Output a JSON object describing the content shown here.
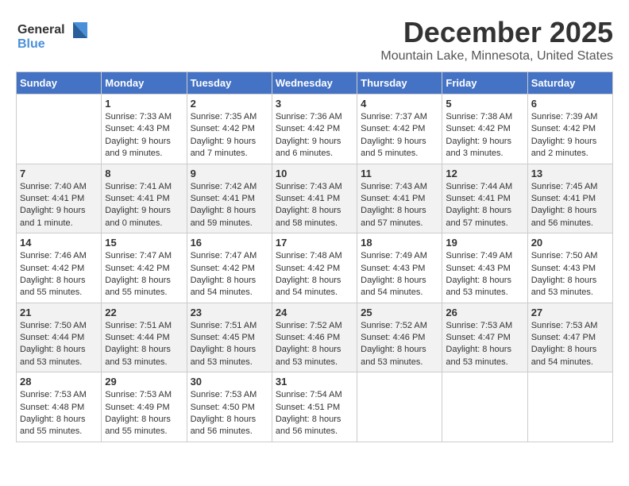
{
  "logo": {
    "text_general": "General",
    "text_blue": "Blue"
  },
  "title": "December 2025",
  "subtitle": "Mountain Lake, Minnesota, United States",
  "days_of_week": [
    "Sunday",
    "Monday",
    "Tuesday",
    "Wednesday",
    "Thursday",
    "Friday",
    "Saturday"
  ],
  "weeks": [
    [
      {
        "day": "",
        "info": ""
      },
      {
        "day": "1",
        "info": "Sunrise: 7:33 AM\nSunset: 4:43 PM\nDaylight: 9 hours\nand 9 minutes."
      },
      {
        "day": "2",
        "info": "Sunrise: 7:35 AM\nSunset: 4:42 PM\nDaylight: 9 hours\nand 7 minutes."
      },
      {
        "day": "3",
        "info": "Sunrise: 7:36 AM\nSunset: 4:42 PM\nDaylight: 9 hours\nand 6 minutes."
      },
      {
        "day": "4",
        "info": "Sunrise: 7:37 AM\nSunset: 4:42 PM\nDaylight: 9 hours\nand 5 minutes."
      },
      {
        "day": "5",
        "info": "Sunrise: 7:38 AM\nSunset: 4:42 PM\nDaylight: 9 hours\nand 3 minutes."
      },
      {
        "day": "6",
        "info": "Sunrise: 7:39 AM\nSunset: 4:42 PM\nDaylight: 9 hours\nand 2 minutes."
      }
    ],
    [
      {
        "day": "7",
        "info": "Sunrise: 7:40 AM\nSunset: 4:41 PM\nDaylight: 9 hours\nand 1 minute."
      },
      {
        "day": "8",
        "info": "Sunrise: 7:41 AM\nSunset: 4:41 PM\nDaylight: 9 hours\nand 0 minutes."
      },
      {
        "day": "9",
        "info": "Sunrise: 7:42 AM\nSunset: 4:41 PM\nDaylight: 8 hours\nand 59 minutes."
      },
      {
        "day": "10",
        "info": "Sunrise: 7:43 AM\nSunset: 4:41 PM\nDaylight: 8 hours\nand 58 minutes."
      },
      {
        "day": "11",
        "info": "Sunrise: 7:43 AM\nSunset: 4:41 PM\nDaylight: 8 hours\nand 57 minutes."
      },
      {
        "day": "12",
        "info": "Sunrise: 7:44 AM\nSunset: 4:41 PM\nDaylight: 8 hours\nand 57 minutes."
      },
      {
        "day": "13",
        "info": "Sunrise: 7:45 AM\nSunset: 4:41 PM\nDaylight: 8 hours\nand 56 minutes."
      }
    ],
    [
      {
        "day": "14",
        "info": "Sunrise: 7:46 AM\nSunset: 4:42 PM\nDaylight: 8 hours\nand 55 minutes."
      },
      {
        "day": "15",
        "info": "Sunrise: 7:47 AM\nSunset: 4:42 PM\nDaylight: 8 hours\nand 55 minutes."
      },
      {
        "day": "16",
        "info": "Sunrise: 7:47 AM\nSunset: 4:42 PM\nDaylight: 8 hours\nand 54 minutes."
      },
      {
        "day": "17",
        "info": "Sunrise: 7:48 AM\nSunset: 4:42 PM\nDaylight: 8 hours\nand 54 minutes."
      },
      {
        "day": "18",
        "info": "Sunrise: 7:49 AM\nSunset: 4:43 PM\nDaylight: 8 hours\nand 54 minutes."
      },
      {
        "day": "19",
        "info": "Sunrise: 7:49 AM\nSunset: 4:43 PM\nDaylight: 8 hours\nand 53 minutes."
      },
      {
        "day": "20",
        "info": "Sunrise: 7:50 AM\nSunset: 4:43 PM\nDaylight: 8 hours\nand 53 minutes."
      }
    ],
    [
      {
        "day": "21",
        "info": "Sunrise: 7:50 AM\nSunset: 4:44 PM\nDaylight: 8 hours\nand 53 minutes."
      },
      {
        "day": "22",
        "info": "Sunrise: 7:51 AM\nSunset: 4:44 PM\nDaylight: 8 hours\nand 53 minutes."
      },
      {
        "day": "23",
        "info": "Sunrise: 7:51 AM\nSunset: 4:45 PM\nDaylight: 8 hours\nand 53 minutes."
      },
      {
        "day": "24",
        "info": "Sunrise: 7:52 AM\nSunset: 4:46 PM\nDaylight: 8 hours\nand 53 minutes."
      },
      {
        "day": "25",
        "info": "Sunrise: 7:52 AM\nSunset: 4:46 PM\nDaylight: 8 hours\nand 53 minutes."
      },
      {
        "day": "26",
        "info": "Sunrise: 7:53 AM\nSunset: 4:47 PM\nDaylight: 8 hours\nand 53 minutes."
      },
      {
        "day": "27",
        "info": "Sunrise: 7:53 AM\nSunset: 4:47 PM\nDaylight: 8 hours\nand 54 minutes."
      }
    ],
    [
      {
        "day": "28",
        "info": "Sunrise: 7:53 AM\nSunset: 4:48 PM\nDaylight: 8 hours\nand 55 minutes."
      },
      {
        "day": "29",
        "info": "Sunrise: 7:53 AM\nSunset: 4:49 PM\nDaylight: 8 hours\nand 55 minutes."
      },
      {
        "day": "30",
        "info": "Sunrise: 7:53 AM\nSunset: 4:50 PM\nDaylight: 8 hours\nand 56 minutes."
      },
      {
        "day": "31",
        "info": "Sunrise: 7:54 AM\nSunset: 4:51 PM\nDaylight: 8 hours\nand 56 minutes."
      },
      {
        "day": "",
        "info": ""
      },
      {
        "day": "",
        "info": ""
      },
      {
        "day": "",
        "info": ""
      }
    ]
  ]
}
